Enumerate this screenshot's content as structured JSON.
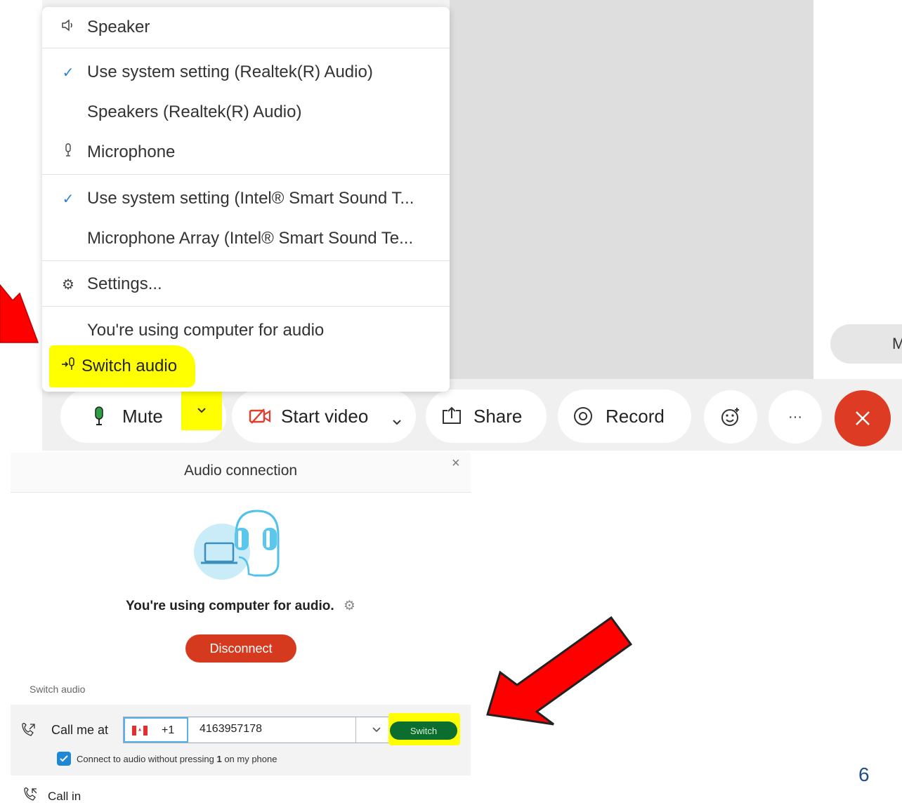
{
  "menu": {
    "speaker_header": "Speaker",
    "speaker_opt1": "Use system setting (Realtek(R) Audio)",
    "speaker_opt2": "Speakers (Realtek(R) Audio)",
    "mic_header": "Microphone",
    "mic_opt1": "Use system setting (Intel® Smart Sound T...",
    "mic_opt2": "Microphone Array (Intel® Smart Sound Te...",
    "settings": "Settings...",
    "status": "You're using computer for audio",
    "switch_audio": "Switch audio"
  },
  "toolbar": {
    "mute": "Mute",
    "start_video": "Start video",
    "share": "Share",
    "record": "Record",
    "more": "···",
    "right_pill_initial": "M"
  },
  "dialog": {
    "title": "Audio connection",
    "close": "×",
    "status": "You're using computer for audio.",
    "disconnect": "Disconnect",
    "switch_audio_label": "Switch audio",
    "call_me_at": "Call me at",
    "country_code": "+1",
    "phone_number": "4163957178",
    "switch_button": "Switch",
    "checkbox_label_pre": "Connect to audio without pressing ",
    "checkbox_label_key": "1",
    "checkbox_label_post": " on my phone",
    "call_in": "Call in"
  },
  "slide_number": "6",
  "colors": {
    "highlight": "#ffff00",
    "arrow_red": "#ff0000",
    "disconnect_red": "#d63a1e",
    "leave_red": "#dd3b23",
    "switch_green": "#0b6e2e",
    "audio_art_blue": "#5cc7ec",
    "checkbox_blue": "#1e88d6"
  }
}
